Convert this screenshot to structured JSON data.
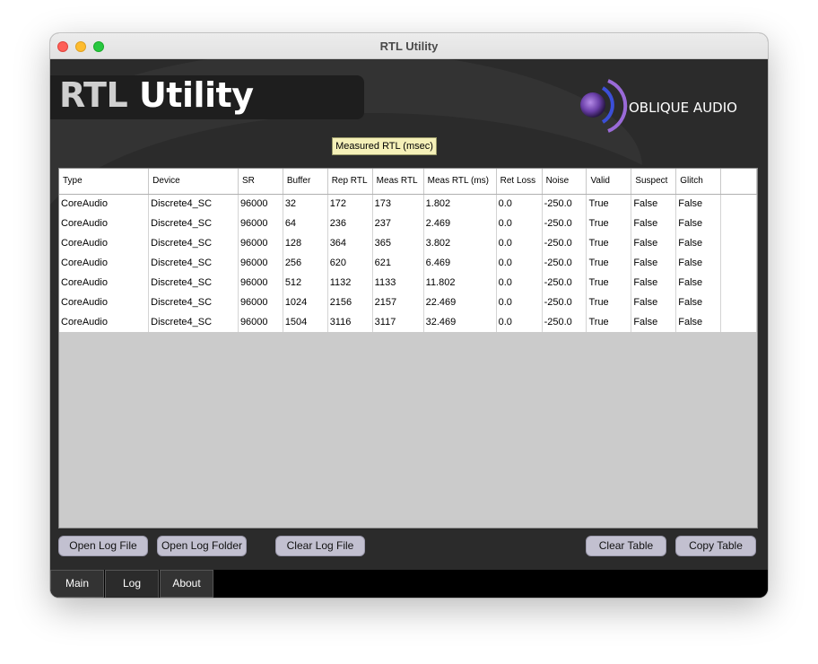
{
  "window": {
    "title": "RTL Utility"
  },
  "header": {
    "title_prefix": "RTL",
    "title_suffix": "Utility",
    "logo_text": "OBLIQUE AUDIO",
    "tooltip": "Measured RTL (msec)"
  },
  "table": {
    "columns": [
      "Type",
      "Device",
      "SR",
      "Buffer",
      "Rep RTL",
      "Meas RTL",
      "Meas RTL (ms)",
      "Ret Loss",
      "Noise",
      "Valid",
      "Suspect",
      "Glitch"
    ],
    "rows": [
      [
        "CoreAudio",
        "Discrete4_SC",
        "96000",
        "32",
        "172",
        "173",
        "1.802",
        "0.0",
        "-250.0",
        "True",
        "False",
        "False"
      ],
      [
        "CoreAudio",
        "Discrete4_SC",
        "96000",
        "64",
        "236",
        "237",
        "2.469",
        "0.0",
        "-250.0",
        "True",
        "False",
        "False"
      ],
      [
        "CoreAudio",
        "Discrete4_SC",
        "96000",
        "128",
        "364",
        "365",
        "3.802",
        "0.0",
        "-250.0",
        "True",
        "False",
        "False"
      ],
      [
        "CoreAudio",
        "Discrete4_SC",
        "96000",
        "256",
        "620",
        "621",
        "6.469",
        "0.0",
        "-250.0",
        "True",
        "False",
        "False"
      ],
      [
        "CoreAudio",
        "Discrete4_SC",
        "96000",
        "512",
        "1132",
        "1133",
        "11.802",
        "0.0",
        "-250.0",
        "True",
        "False",
        "False"
      ],
      [
        "CoreAudio",
        "Discrete4_SC",
        "96000",
        "1024",
        "2156",
        "2157",
        "22.469",
        "0.0",
        "-250.0",
        "True",
        "False",
        "False"
      ],
      [
        "CoreAudio",
        "Discrete4_SC",
        "96000",
        "1504",
        "3116",
        "3117",
        "32.469",
        "0.0",
        "-250.0",
        "True",
        "False",
        "False"
      ]
    ]
  },
  "buttons": {
    "open_log_file": "Open Log File",
    "open_log_folder": "Open Log Folder",
    "clear_log_file": "Clear Log File",
    "clear_table": "Clear Table",
    "copy_table": "Copy Table"
  },
  "tabs": [
    {
      "label": "Main",
      "active": false
    },
    {
      "label": "Log",
      "active": true
    },
    {
      "label": "About",
      "active": false
    }
  ],
  "colors": {
    "background": "#2b2b2b",
    "button": "#c2c0d0",
    "tooltip": "#f5f0b8",
    "logo_accent": "#8a5cc8"
  }
}
